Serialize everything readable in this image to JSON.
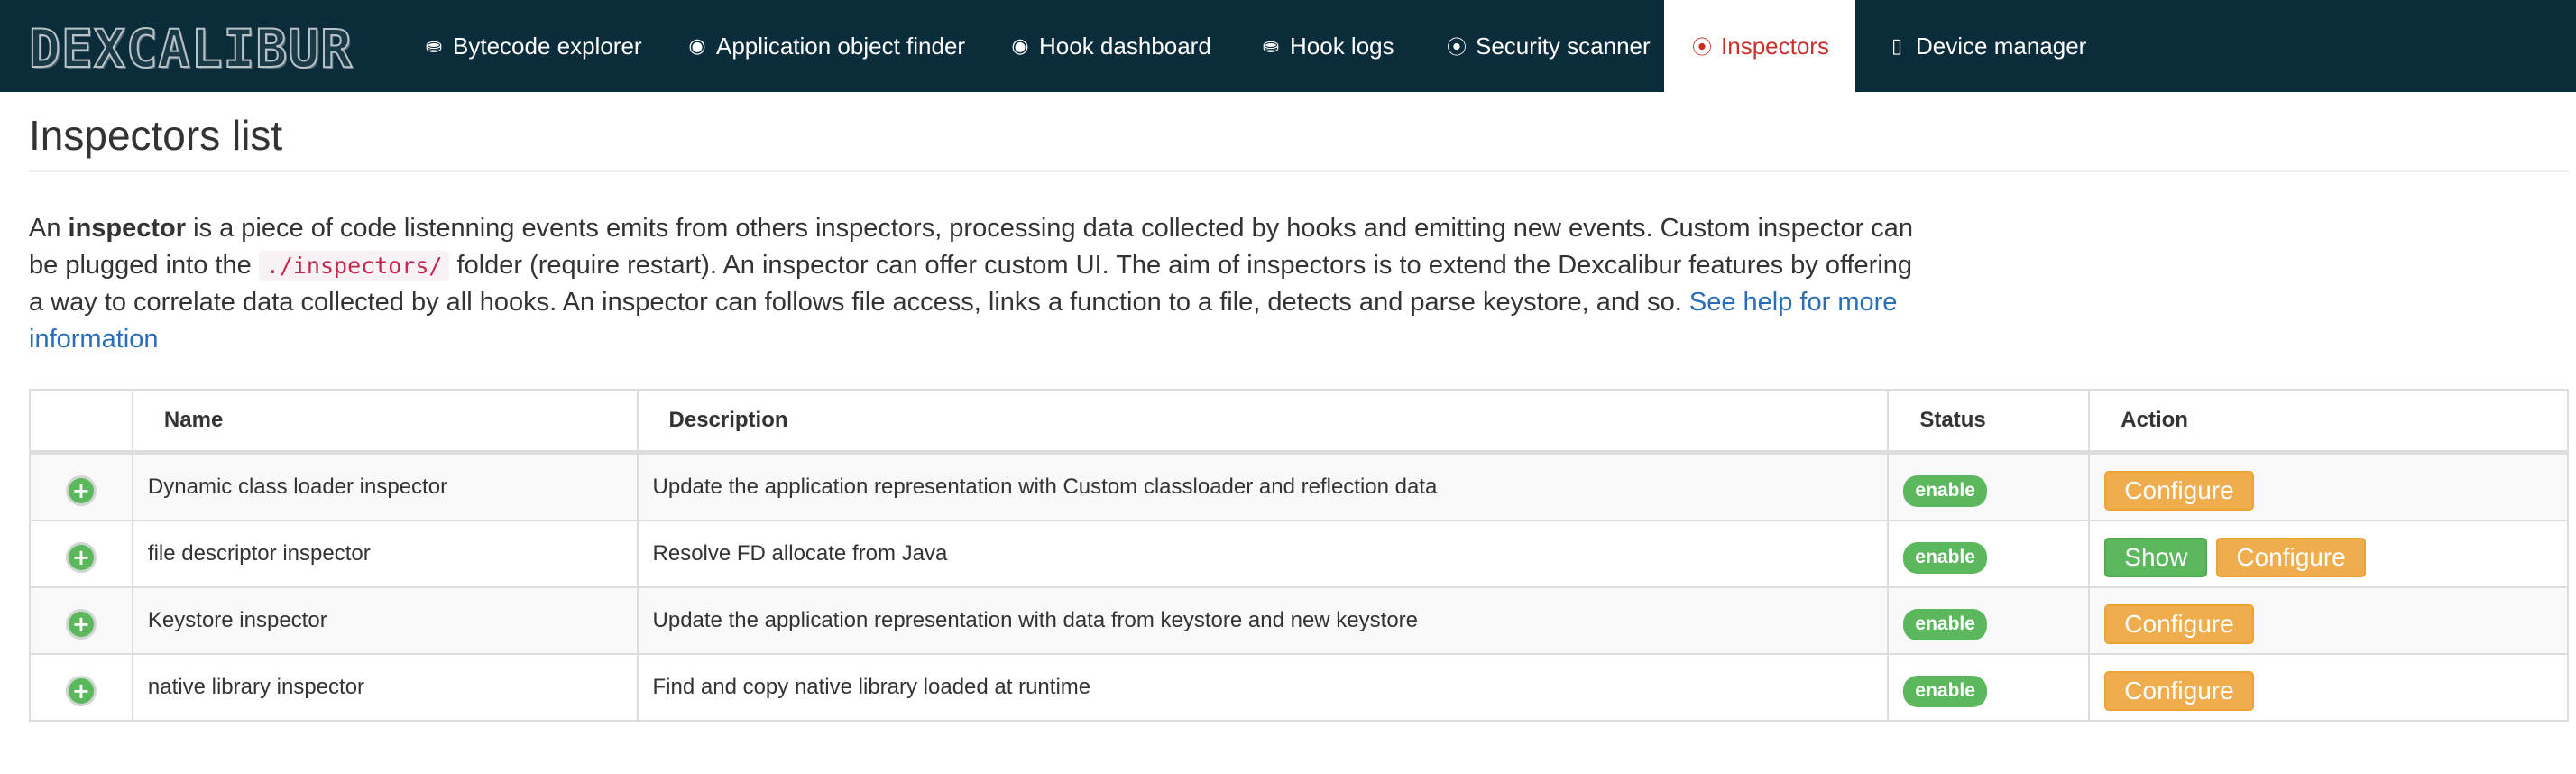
{
  "navbar": {
    "logo": "DEXCALIBUR",
    "items": [
      {
        "label": "Bytecode explorer",
        "icon": "database-icon"
      },
      {
        "label": "Application object finder",
        "icon": "eye-icon"
      },
      {
        "label": "Hook dashboard",
        "icon": "eye-icon"
      },
      {
        "label": "Hook logs",
        "icon": "database-icon"
      },
      {
        "label": "Security scanner",
        "icon": "compass-icon"
      },
      {
        "label": "Inspectors",
        "icon": "compass-icon",
        "active": true
      },
      {
        "label": "Device manager",
        "icon": "mobile-icon"
      }
    ]
  },
  "page": {
    "title": "Inspectors list",
    "intro": {
      "p1": "An ",
      "bold": "inspector",
      "p2": " is a piece of code listenning events emits from others inspectors, processing data collected by hooks and emitting new events. Custom inspector can be plugged into the ",
      "code": "./inspectors/",
      "p3": " folder (require restart). An inspector can offer custom UI. The aim of inspectors is to extend the Dexcalibur features by offering a way to correlate data collected by all hooks. An inspector can follows file access, links a function to a file, detects and parse keystore, and so. ",
      "link": "See help for more information"
    }
  },
  "table": {
    "headers": [
      "",
      "Name",
      "Description",
      "Status",
      "Action"
    ],
    "rows": [
      {
        "name": "Dynamic class loader inspector",
        "description": "Update the application representation with Custom classloader and reflection data",
        "status": "enable",
        "actions": [
          "Configure"
        ]
      },
      {
        "name": "file descriptor inspector",
        "description": "Resolve FD allocate from Java",
        "status": "enable",
        "actions": [
          "Show",
          "Configure"
        ]
      },
      {
        "name": "Keystore inspector",
        "description": "Update the application representation with data from keystore and new keystore",
        "status": "enable",
        "actions": [
          "Configure"
        ]
      },
      {
        "name": "native library inspector",
        "description": "Find and copy native library loaded at runtime",
        "status": "enable",
        "actions": [
          "Configure"
        ]
      }
    ]
  },
  "colors": {
    "navbar_bg": "#0b2c3a",
    "active_tab_text": "#c9302c",
    "success": "#5cb85c",
    "warning": "#f0ad4e",
    "link": "#2a6eb8"
  }
}
